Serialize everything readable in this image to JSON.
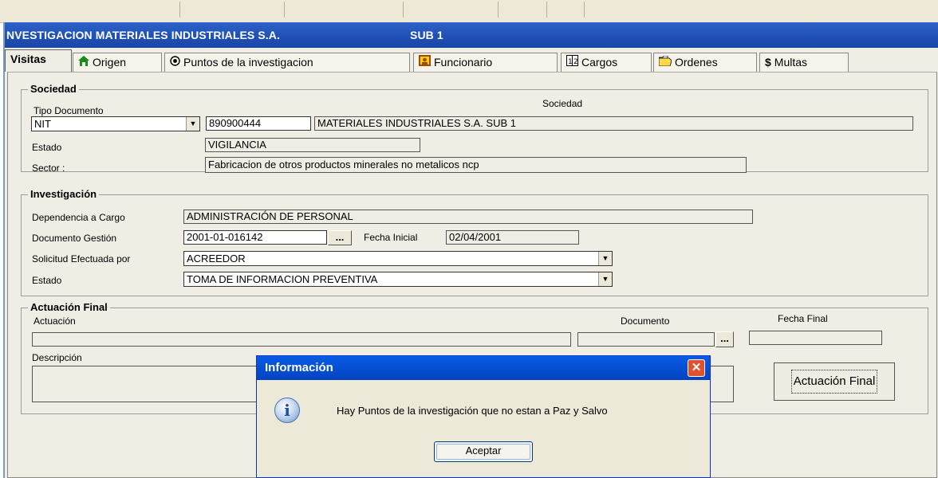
{
  "window": {
    "title": "NVESTIGACION MATERIALES INDUSTRIALES S.A.",
    "subtitle": "SUB 1"
  },
  "tabs": [
    {
      "label": "Visitas",
      "icon": ""
    },
    {
      "label": "Origen",
      "icon": "house-icon"
    },
    {
      "label": "Puntos de la investigacion",
      "icon": "radio-icon"
    },
    {
      "label": "Funcionario",
      "icon": "person-icon"
    },
    {
      "label": "Cargos",
      "icon": "numbers-icon"
    },
    {
      "label": "Ordenes",
      "icon": "folder-icon"
    },
    {
      "label": "Multas",
      "icon": "dollar-icon"
    }
  ],
  "sociedad": {
    "legend": "Sociedad",
    "tipo_documento_label": "Tipo Documento",
    "tipo_documento_value": "NIT",
    "sociedad_label": "Sociedad",
    "nit_value": "890900444",
    "sociedad_value": "MATERIALES INDUSTRIALES S.A.     SUB 1",
    "estado_label": "Estado",
    "estado_value": "VIGILANCIA",
    "sector_label": "Sector :",
    "sector_value": "Fabricacion de otros productos minerales  no metalicos  ncp"
  },
  "investigacion": {
    "legend": "Investigación",
    "dependencia_label": "Dependencia a Cargo",
    "dependencia_value": "ADMINISTRACIÓN DE PERSONAL",
    "documento_label": "Documento Gestión",
    "documento_value": "2001-01-016142",
    "browse_label": "...",
    "fecha_inicial_label": "Fecha Inicial",
    "fecha_inicial_value": "02/04/2001",
    "solicitud_label": "Solicitud Efectuada por",
    "solicitud_value": "ACREEDOR",
    "estado_label": "Estado",
    "estado_value": "TOMA DE INFORMACION PREVENTIVA"
  },
  "actuacion": {
    "legend": "Actuación Final",
    "actuacion_label": "Actuación",
    "actuacion_value": "",
    "documento_label": "Documento",
    "documento_value": "",
    "browse_label": "...",
    "fecha_final_label": "Fecha Final",
    "fecha_final_value": "",
    "descripcion_label": "Descripción",
    "descripcion_value": "",
    "button_label": "Actuación Final"
  },
  "dialog": {
    "title": "Información",
    "close_label": "✕",
    "icon": "info-icon",
    "icon_glyph": "i",
    "message": "Hay Puntos de la investigación que no estan a Paz y Salvo",
    "button_label": "Aceptar"
  },
  "colors": {
    "titlebar": "#1f4fb4",
    "dialog_title": "#0552d8",
    "close_button": "#e2512e",
    "panel_bg": "#f0ede4"
  }
}
